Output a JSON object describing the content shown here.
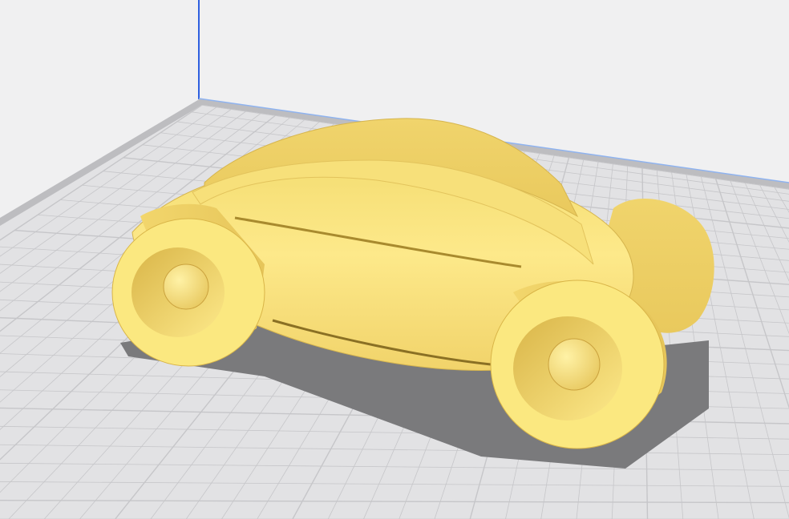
{
  "viewport": {
    "background_color": "#f0f0f1",
    "build_plate_color": "#e2e2e4",
    "grid_line_color": "#c6c6c9",
    "plate_border_color": "#bdbdc0",
    "z_axis_color": "#2e5fe0",
    "x_axis_color": "#8fb3ef",
    "model_color": "#fcea7d",
    "model_shade_color": "#e8c85a",
    "shadow_color": "#7a7a7c"
  },
  "scene": {
    "model_name": "car-model",
    "model_icon": "car-icon"
  }
}
